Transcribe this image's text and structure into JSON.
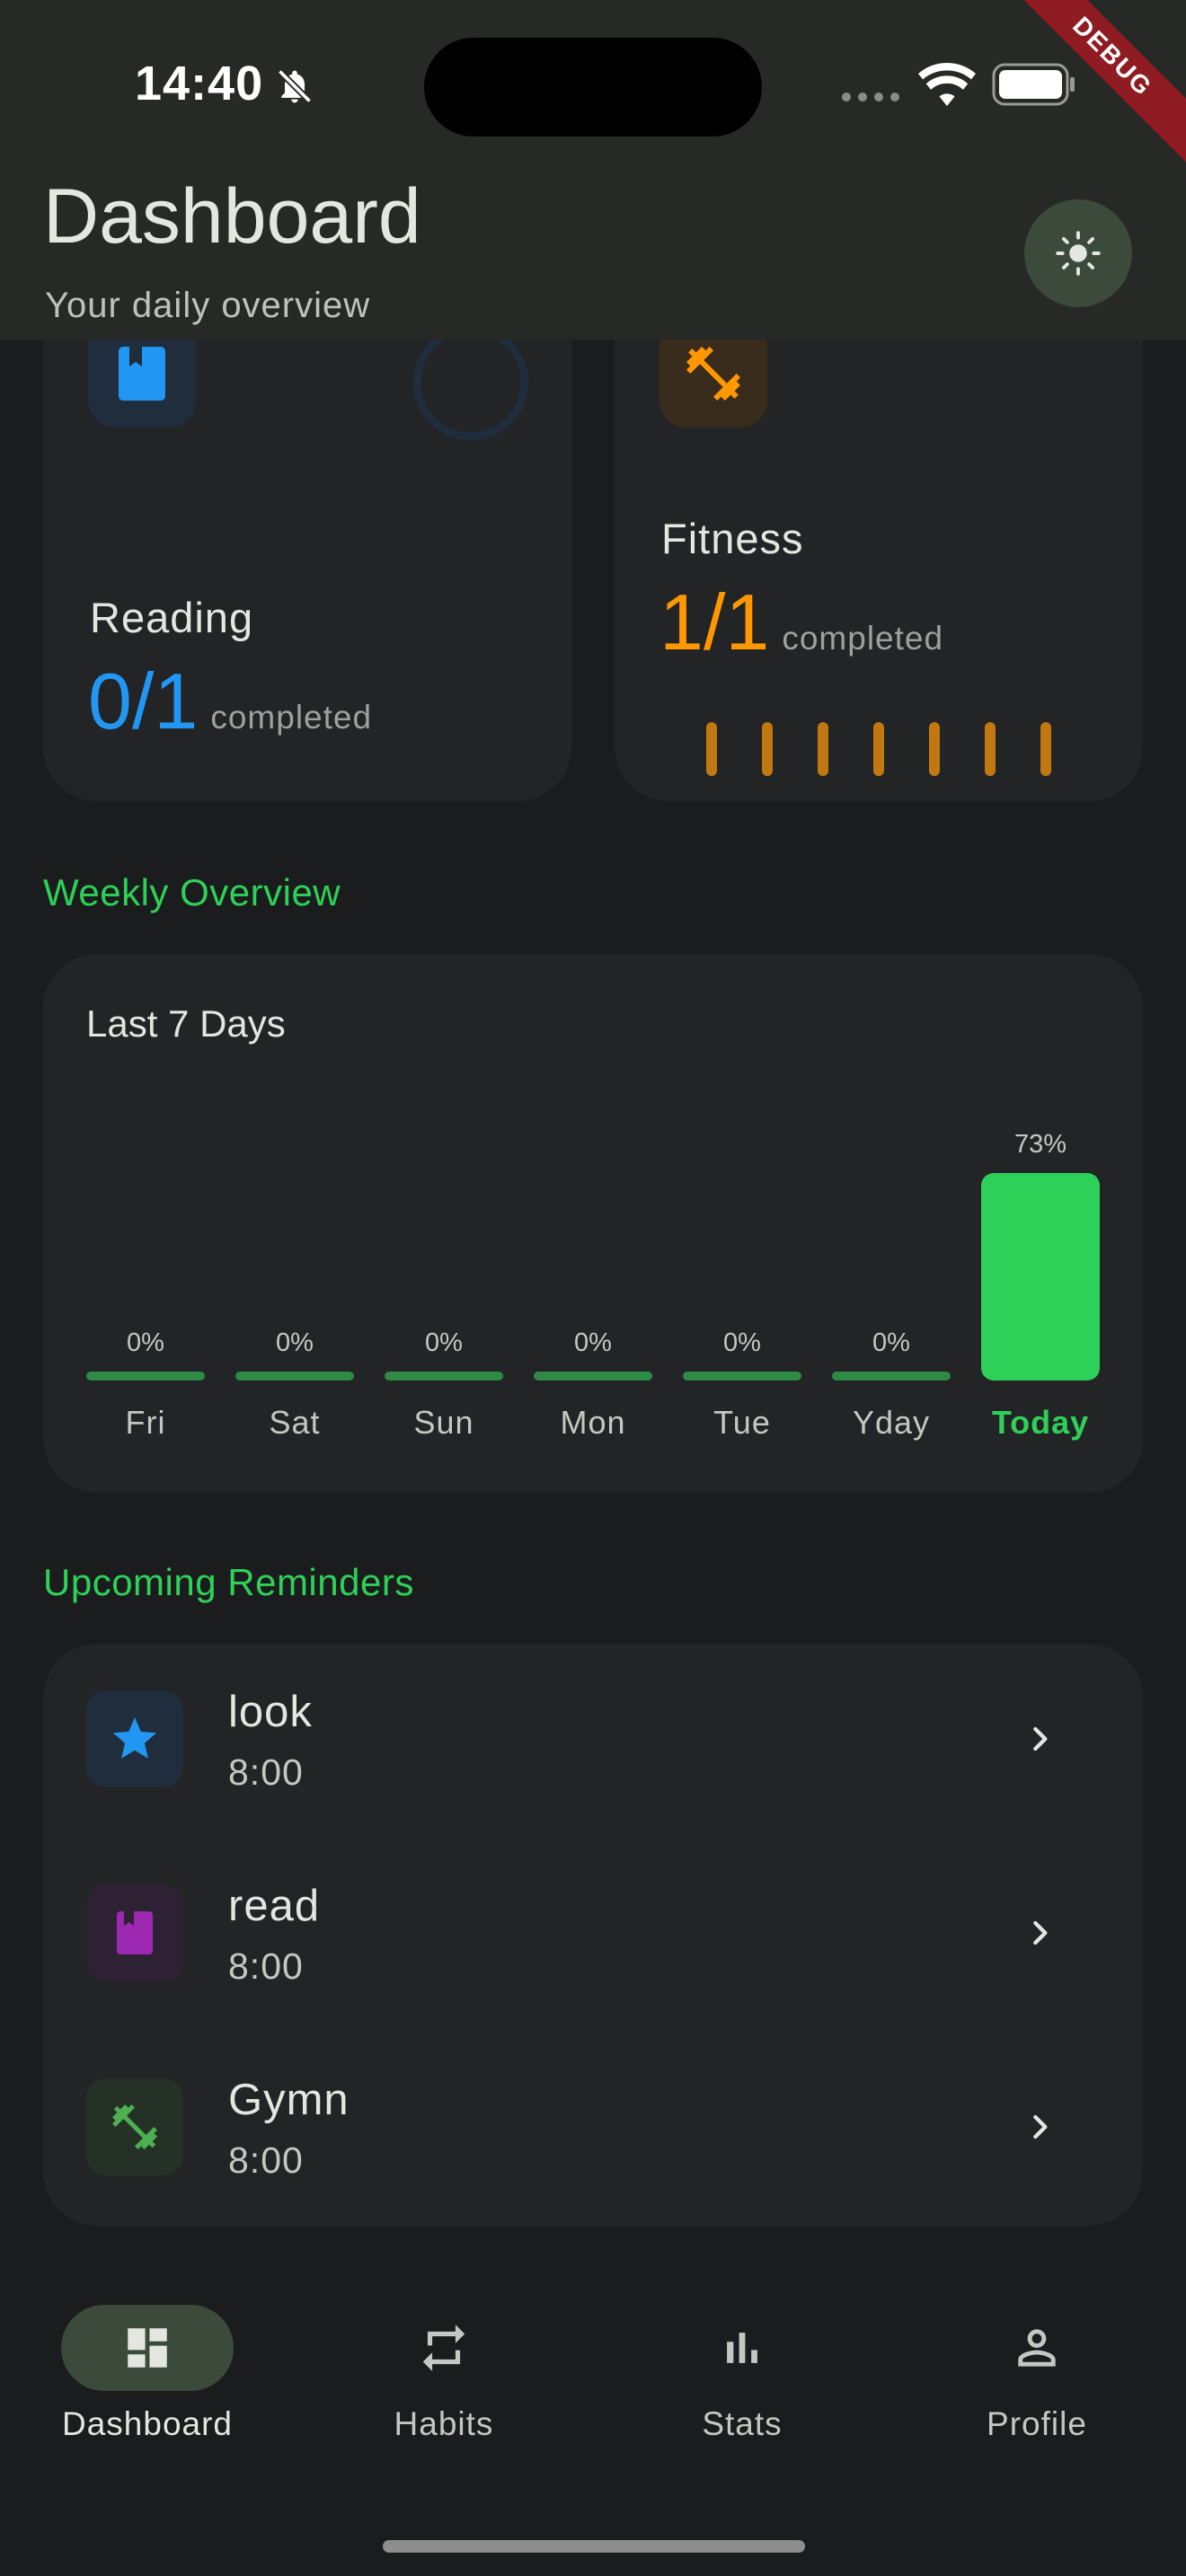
{
  "status_bar": {
    "time": "14:40"
  },
  "header": {
    "title": "Dashboard",
    "subtitle": "Your daily overview",
    "debug_label": "DEBUG"
  },
  "categories": [
    {
      "name": "Reading",
      "done": "0",
      "total": "1",
      "completed_label": "completed",
      "color": "#2196f3"
    },
    {
      "name": "Fitness",
      "done": "1",
      "total": "1",
      "completed_label": "completed",
      "color": "#ff9800"
    }
  ],
  "weekly": {
    "section_title": "Weekly Overview",
    "card_title": "Last 7 Days",
    "days": [
      {
        "label": "Fri",
        "value": 0,
        "value_label": "0%"
      },
      {
        "label": "Sat",
        "value": 0,
        "value_label": "0%"
      },
      {
        "label": "Sun",
        "value": 0,
        "value_label": "0%"
      },
      {
        "label": "Mon",
        "value": 0,
        "value_label": "0%"
      },
      {
        "label": "Tue",
        "value": 0,
        "value_label": "0%"
      },
      {
        "label": "Yday",
        "value": 0,
        "value_label": "0%"
      },
      {
        "label": "Today",
        "value": 73,
        "value_label": "73%"
      }
    ]
  },
  "reminders": {
    "section_title": "Upcoming Reminders",
    "items": [
      {
        "name": "look",
        "time": "8:00",
        "icon": "star-icon",
        "color": "#2196f3"
      },
      {
        "name": "read",
        "time": "8:00",
        "icon": "book-icon",
        "color": "#9c27b0"
      },
      {
        "name": "Gymn",
        "time": "8:00",
        "icon": "dumbbell-icon",
        "color": "#4caf50"
      }
    ]
  },
  "nav": {
    "items": [
      {
        "label": "Dashboard",
        "icon": "dashboard-icon",
        "active": true
      },
      {
        "label": "Habits",
        "icon": "repeat-icon",
        "active": false
      },
      {
        "label": "Stats",
        "icon": "bar-chart-icon",
        "active": false
      },
      {
        "label": "Profile",
        "icon": "person-icon",
        "active": false
      }
    ]
  },
  "colors": {
    "accent": "#2ed158",
    "background": "#1b1c1e",
    "card": "#232425",
    "header": "#272926"
  }
}
